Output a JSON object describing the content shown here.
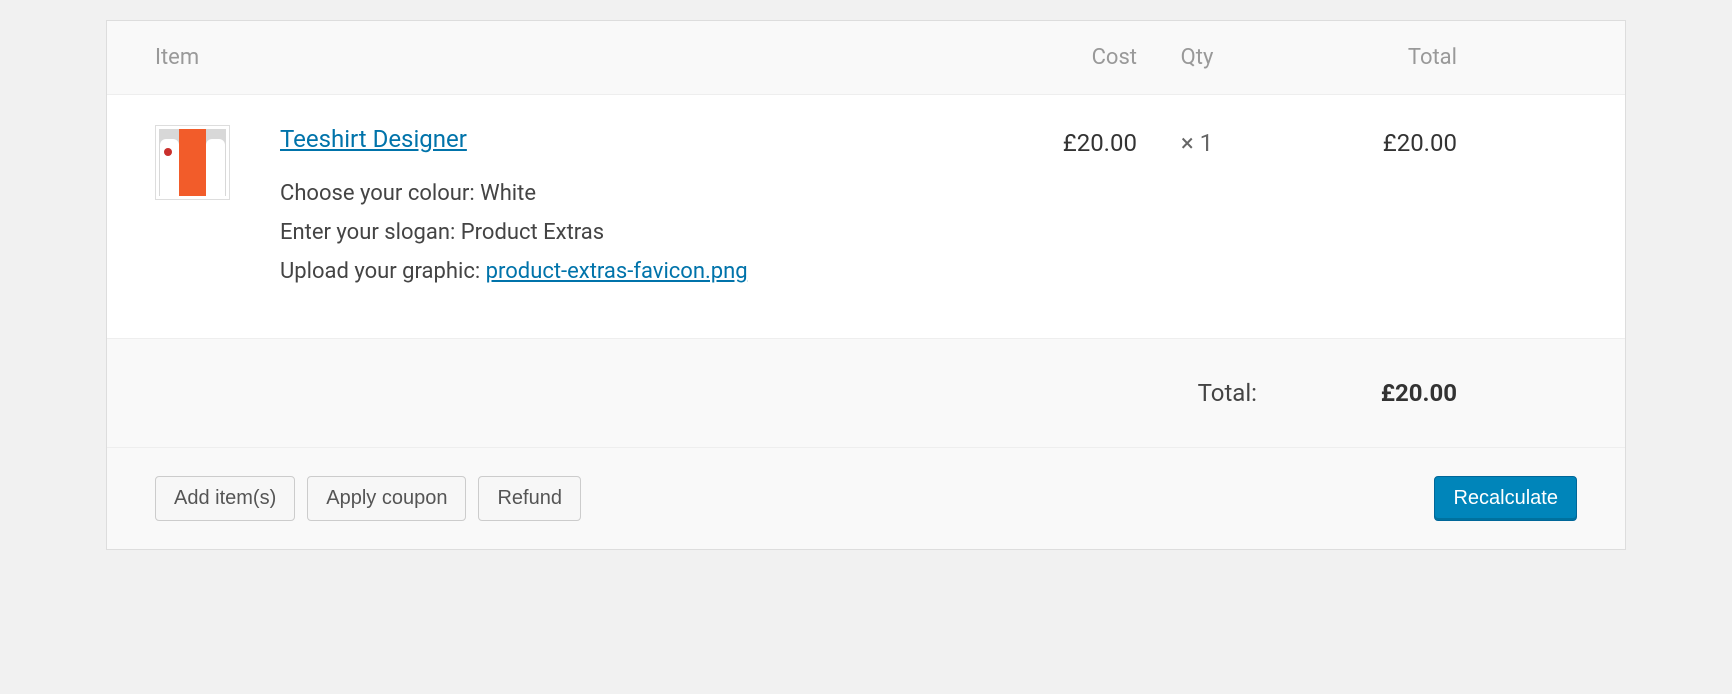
{
  "headers": {
    "item": "Item",
    "cost": "Cost",
    "qty": "Qty",
    "total": "Total"
  },
  "item": {
    "name": "Teeshirt Designer",
    "cost": "£20.00",
    "qty_prefix": "×",
    "qty": "1",
    "line_total": "£20.00",
    "meta": {
      "colour_label": "Choose your colour: ",
      "colour_value": "White",
      "slogan_label": "Enter your slogan: ",
      "slogan_value": "Product Extras",
      "graphic_label": "Upload your graphic: ",
      "graphic_value": "product-extras-favicon.png"
    }
  },
  "totals": {
    "label": "Total:",
    "amount": "£20.00"
  },
  "actions": {
    "add_items": "Add item(s)",
    "apply_coupon": "Apply coupon",
    "refund": "Refund",
    "recalculate": "Recalculate"
  }
}
